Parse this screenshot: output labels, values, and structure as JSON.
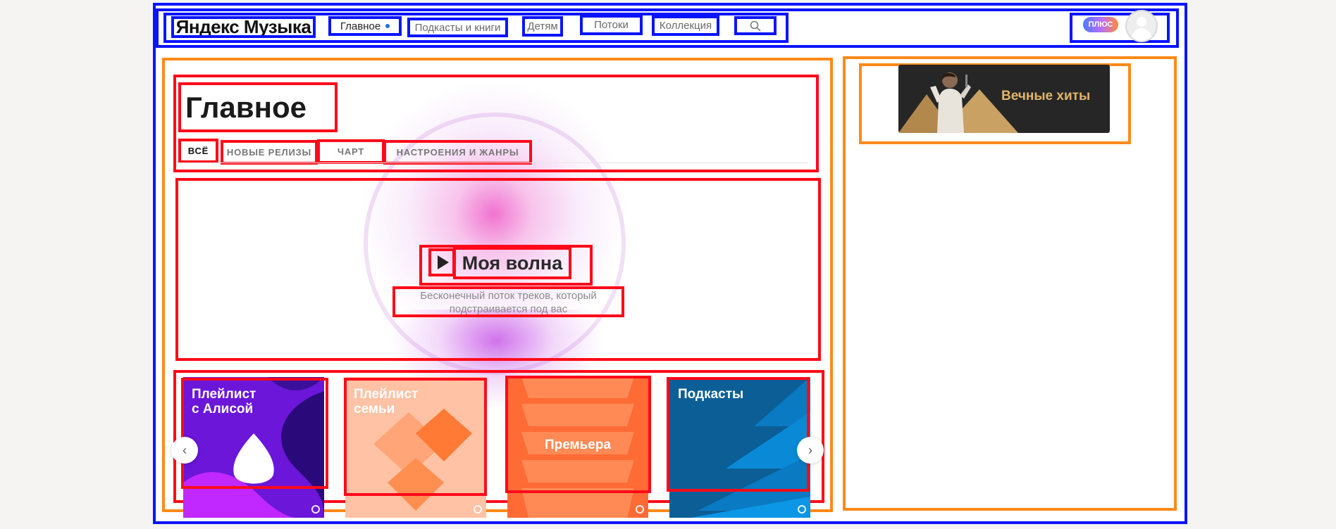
{
  "header": {
    "logo": "Яндекс Музыка",
    "nav": [
      {
        "label": "Главное",
        "active": true
      },
      {
        "label": "Подкасты и книги"
      },
      {
        "label": "Детям"
      },
      {
        "label": "Потоки"
      },
      {
        "label": "Коллекция"
      }
    ],
    "search_icon": "search-icon",
    "plus_label": "ПЛЮС"
  },
  "main": {
    "title": "Главное",
    "tabs": [
      {
        "label": "ВСЁ",
        "active": true
      },
      {
        "label": "НОВЫЕ РЕЛИЗЫ"
      },
      {
        "label": "ЧАРТ"
      },
      {
        "label": "НАСТРОЕНИЯ И ЖАНРЫ"
      }
    ],
    "wave": {
      "title": "Моя волна",
      "description": "Бесконечный поток треков, который подстраивается под вас"
    },
    "cards": [
      {
        "label_line1": "Плейлист",
        "label_line2": "с Алисой",
        "color": "#7a1de0"
      },
      {
        "label_line1": "Плейлист",
        "label_line2": "семьи",
        "color": "#ffc2a4"
      },
      {
        "label_line1": "Премьера",
        "label_line2": "",
        "color": "#ff6b35"
      },
      {
        "label_line1": "Подкасты",
        "label_line2": "",
        "color": "#0b6aa6"
      }
    ]
  },
  "sidebar": {
    "banner_text": "Вечные хиты"
  },
  "colors": {
    "annotation_blue": "#0a14ff",
    "annotation_red": "#ff0a1a",
    "annotation_orange": "#ff8a1a",
    "nav_dot": "#1f6fe0"
  }
}
